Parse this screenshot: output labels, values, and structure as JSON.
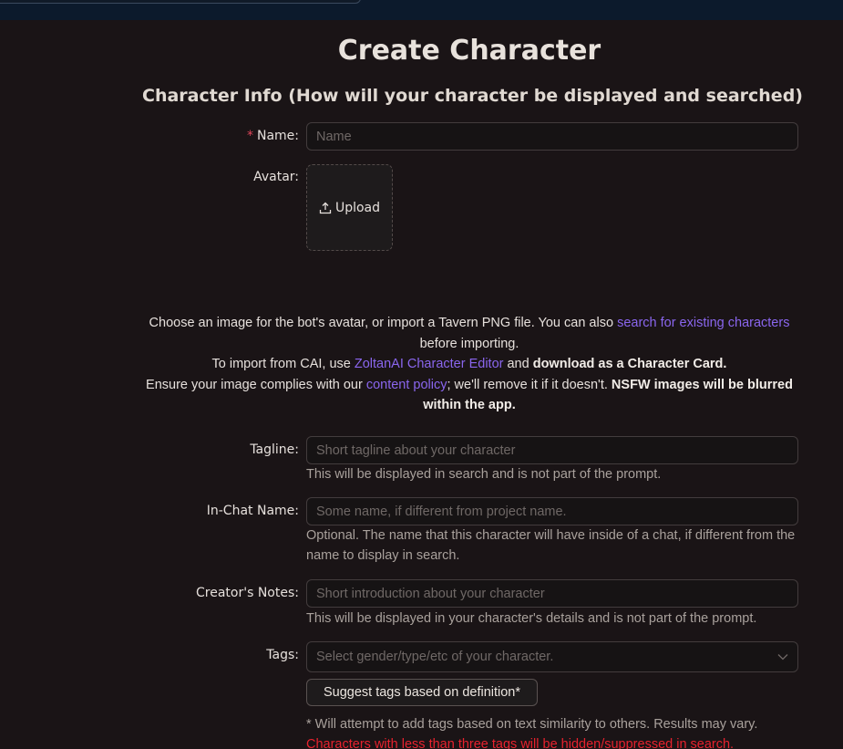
{
  "page": {
    "title": "Create Character",
    "section_title": "Character Info (How will your character be displayed and searched)"
  },
  "fields": {
    "name": {
      "label": "Name",
      "required_mark": "*",
      "placeholder": "Name",
      "value": ""
    },
    "avatar": {
      "label": "Avatar",
      "upload_label": "Upload"
    },
    "tagline": {
      "label": "Tagline",
      "placeholder": "Short tagline about your character",
      "help": "This will be displayed in search and is not part of the prompt."
    },
    "in_chat_name": {
      "label": "In-Chat Name",
      "placeholder": "Some name, if different from project name.",
      "help": "Optional. The name that this character will have inside of a chat, if different from the name to display in search."
    },
    "creators_notes": {
      "label": "Creator's Notes",
      "placeholder": "Short introduction about your character",
      "help": "This will be displayed in your character's details and is not part of the prompt."
    },
    "tags": {
      "label": "Tags",
      "placeholder": "Select gender/type/etc of your character.",
      "suggest_button": "Suggest tags based on definition*",
      "note": "* Will attempt to add tags based on text similarity to others. Results may vary.",
      "warning": "Characters with less than three tags will be hidden/suppressed in search."
    }
  },
  "avatar_info": {
    "line1_pre": "Choose an image for the bot's avatar, or import a Tavern PNG file. You can also ",
    "line1_link": "search for existing characters",
    "line1_post": " before importing.",
    "line2_pre": "To import from CAI, use ",
    "line2_link": "ZoltanAI Character Editor",
    "line2_mid": " and ",
    "line2_bold": "download as a Character Card.",
    "line3_pre": "Ensure your image complies with our ",
    "line3_link": "content policy",
    "line3_mid": "; we'll remove it if it doesn't. ",
    "line3_bold": "NSFW images will be blurred within the app."
  },
  "colors": {
    "background": "#1a1416",
    "link": "#8a66ee",
    "required": "#e0455a",
    "warning": "#e8222e"
  }
}
